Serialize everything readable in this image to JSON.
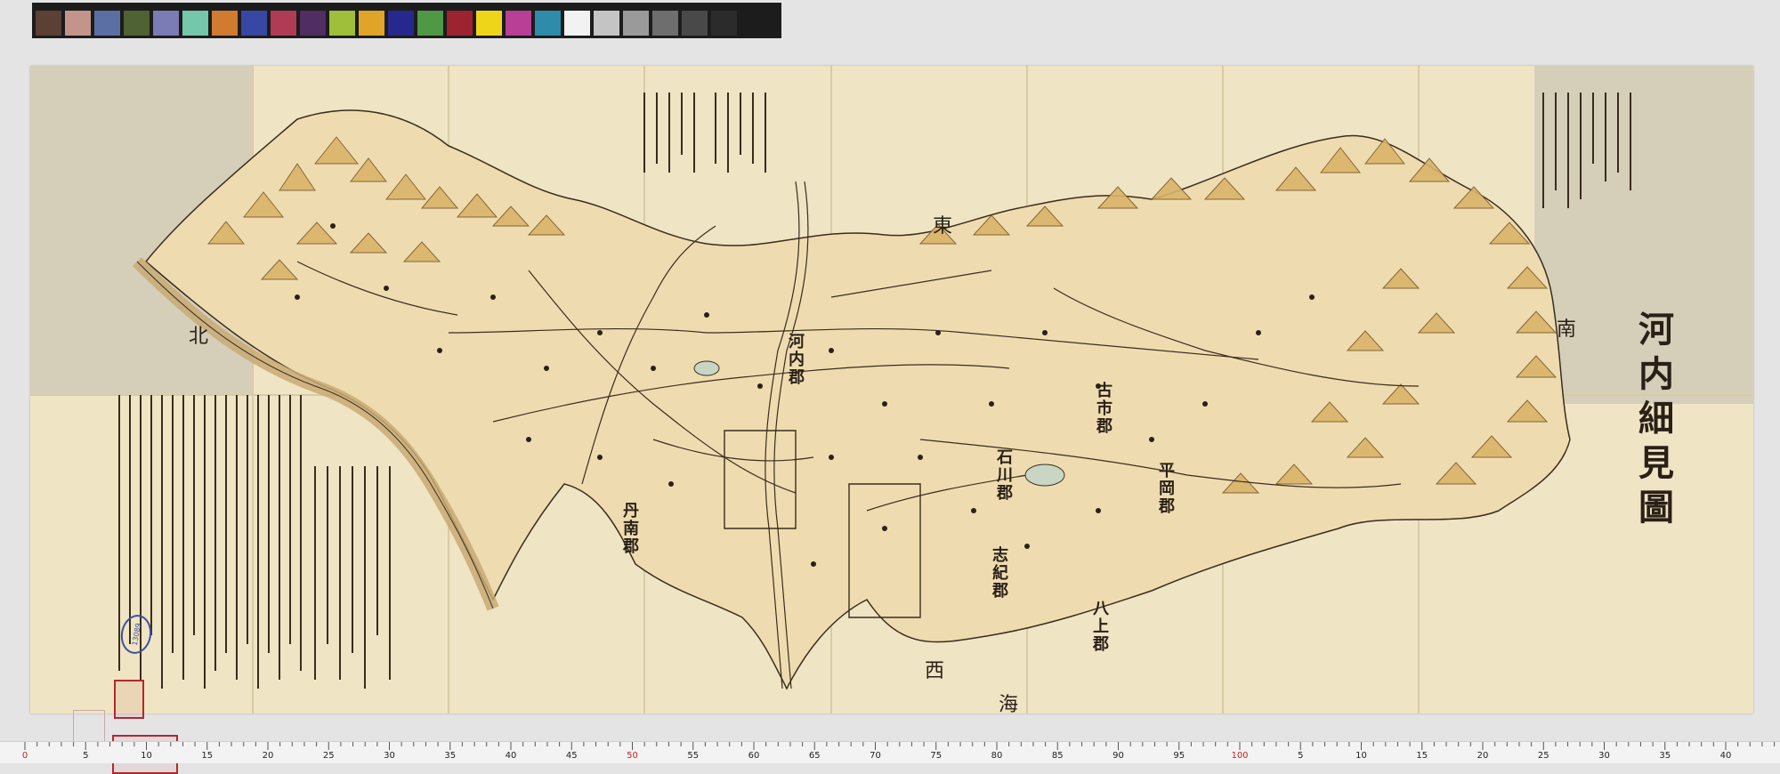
{
  "color_checker": {
    "chips": [
      "#5b4034",
      "#c3948a",
      "#5b6fa4",
      "#4f6233",
      "#7b7bb6",
      "#74c7aa",
      "#d07b2f",
      "#3847a3",
      "#b03b54",
      "#502d62",
      "#9fbe3a",
      "#e0a428",
      "#26288e",
      "#4f9845",
      "#9c2330",
      "#eed51a",
      "#b83e96",
      "#2e8ba9",
      "#f2f2f2",
      "#c4c4c4",
      "#9a9a9a",
      "#6e6e6e",
      "#494949",
      "#2b2b2b"
    ]
  },
  "map": {
    "title": "河内細見圖",
    "directions": {
      "north": "北",
      "east": "東",
      "south": "南",
      "west": "西"
    },
    "districts": [
      {
        "id": "furuichi",
        "text": "古市郡"
      },
      {
        "id": "hiraoka",
        "text": "平岡郡"
      },
      {
        "id": "yakami",
        "text": "八上郡"
      },
      {
        "id": "ishikawa",
        "text": "石川郡"
      },
      {
        "id": "kawachi",
        "text": "河内郡"
      },
      {
        "id": "tannan",
        "text": "丹南郡"
      },
      {
        "id": "shiki",
        "text": "志紀郡"
      }
    ],
    "sea": "海",
    "stamp_number": "13089",
    "colors": {
      "paper": "#efe4c3",
      "mountain": "#d9b46a",
      "river": "#c8aa74",
      "ink": "#2a2017",
      "seal": "#b3272e",
      "ribbon": "#3b4f9c"
    }
  },
  "ruler": {
    "labels": [
      "0",
      "5",
      "10",
      "15",
      "20",
      "25",
      "30",
      "35",
      "40",
      "45",
      "50",
      "55",
      "60",
      "65",
      "70",
      "75",
      "80",
      "85",
      "90",
      "95",
      "100",
      "5",
      "10",
      "15",
      "20",
      "25",
      "30",
      "35",
      "40"
    ],
    "red_labels": [
      "0",
      "50",
      "100"
    ]
  }
}
